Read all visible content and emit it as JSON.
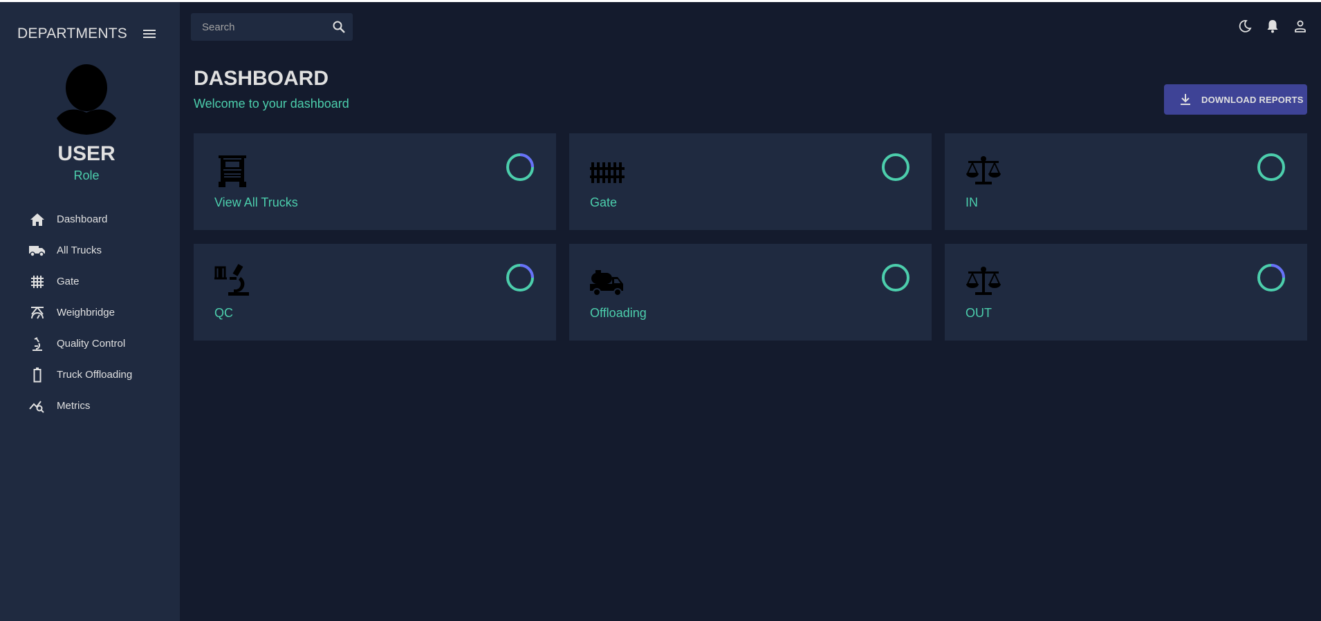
{
  "sidebar": {
    "title": "DEPARTMENTS",
    "user": {
      "name": "USER",
      "role": "Role"
    },
    "items": [
      {
        "label": "Dashboard",
        "icon": "home-icon"
      },
      {
        "label": "All Trucks",
        "icon": "truck-icon"
      },
      {
        "label": "Gate",
        "icon": "gate-grid-icon"
      },
      {
        "label": "Weighbridge",
        "icon": "scale-icon"
      },
      {
        "label": "Quality Control",
        "icon": "microscope-icon"
      },
      {
        "label": "Truck Offloading",
        "icon": "battery-icon"
      },
      {
        "label": "Metrics",
        "icon": "query-stats-icon"
      }
    ]
  },
  "topbar": {
    "search_placeholder": "Search",
    "icons": [
      "dark-mode-icon",
      "notifications-icon",
      "person-icon"
    ]
  },
  "header": {
    "title": "DASHBOARD",
    "subtitle": "Welcome to your dashboard",
    "download_label": "DOWNLOAD REPORTS"
  },
  "cards": [
    {
      "label": "View All Trucks",
      "icon": "semi-truck-icon",
      "progress": 0.25
    },
    {
      "label": "Gate",
      "icon": "fence-icon",
      "progress": 0
    },
    {
      "label": "IN",
      "icon": "balance-scale-icon",
      "progress": 0
    },
    {
      "label": "QC",
      "icon": "lab-microscope-icon",
      "progress": 0.25
    },
    {
      "label": "Offloading",
      "icon": "tanker-truck-icon",
      "progress": 0
    },
    {
      "label": "OUT",
      "icon": "balance-scale-icon",
      "progress": 0.25
    }
  ],
  "colors": {
    "background": "#141b2d",
    "panel": "#1f2a40",
    "accent_green": "#4cceac",
    "accent_blue": "#6870fa",
    "button": "#3e4396"
  }
}
